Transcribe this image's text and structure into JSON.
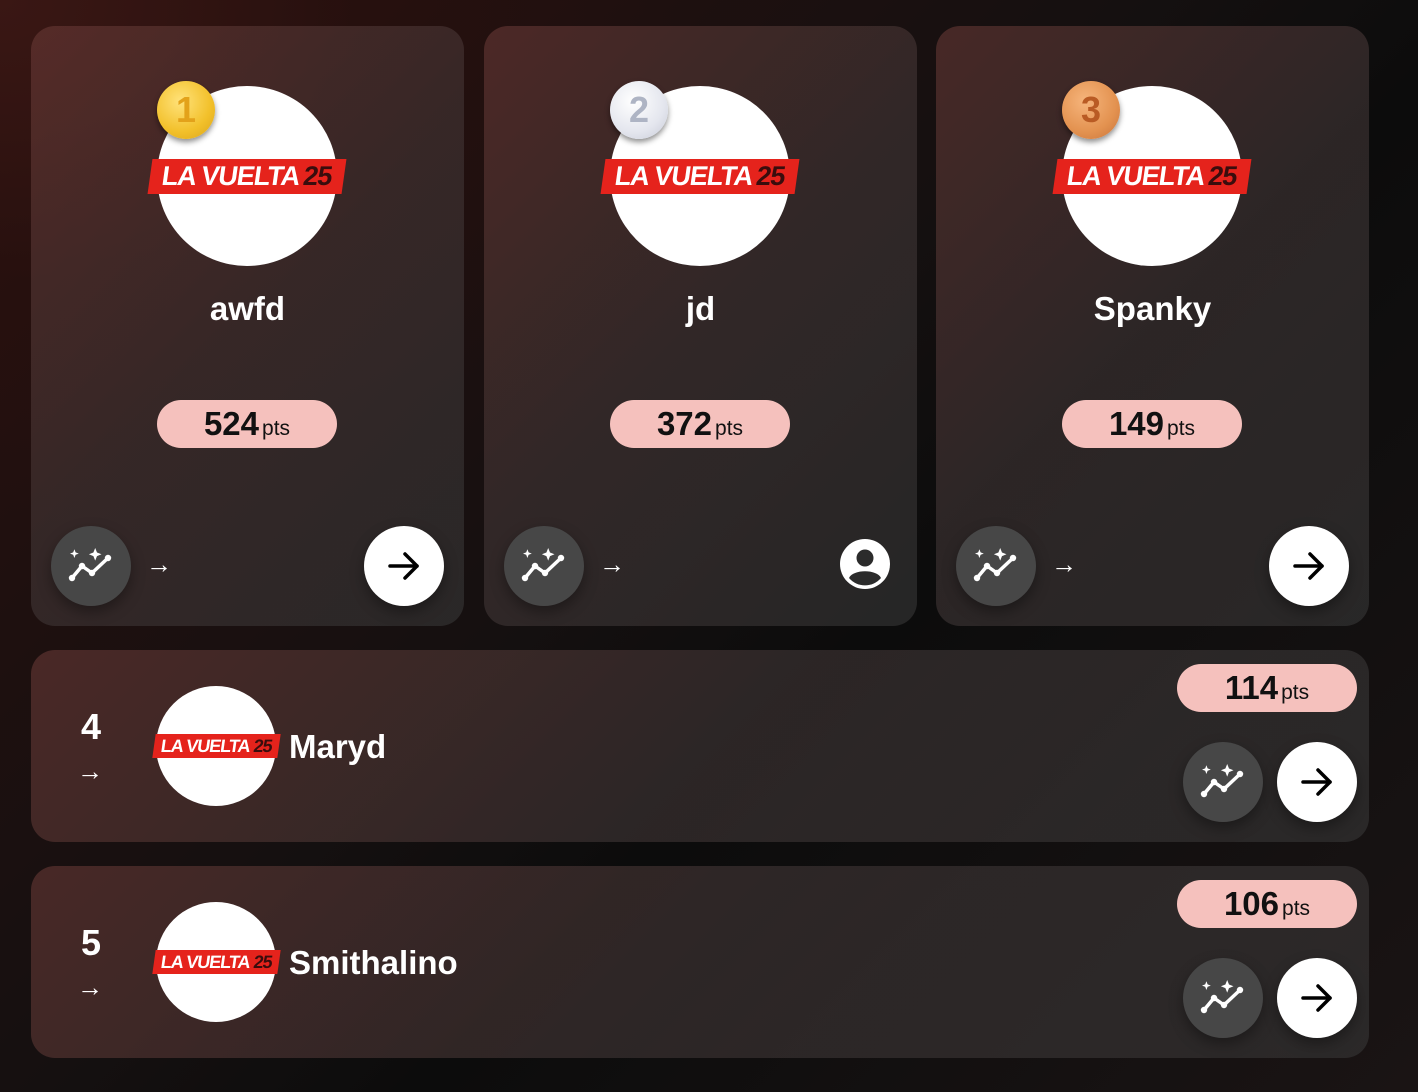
{
  "leaderboard": {
    "pts_unit": "pts",
    "trend_symbol": "→",
    "logo": {
      "text": "LA VUELTA",
      "year": "25"
    },
    "podium": [
      {
        "rank": "1",
        "medal": "gold",
        "name": "awfd",
        "points": "524",
        "action": "arrow-right-icon"
      },
      {
        "rank": "2",
        "medal": "silver",
        "name": "jd",
        "points": "372",
        "action": "user-profile-icon"
      },
      {
        "rank": "3",
        "medal": "bronze",
        "name": "Spanky",
        "points": "149",
        "action": "arrow-right-icon"
      }
    ],
    "rows": [
      {
        "rank": "4",
        "name": "Maryd",
        "points": "114"
      },
      {
        "rank": "5",
        "name": "Smithalino",
        "points": "106"
      }
    ]
  },
  "colors": {
    "points_pill": "#f5c1bd",
    "logo_red": "#e5231c",
    "gold": "#f2c02a",
    "silver": "#e4e6ee",
    "bronze": "#e39250"
  }
}
